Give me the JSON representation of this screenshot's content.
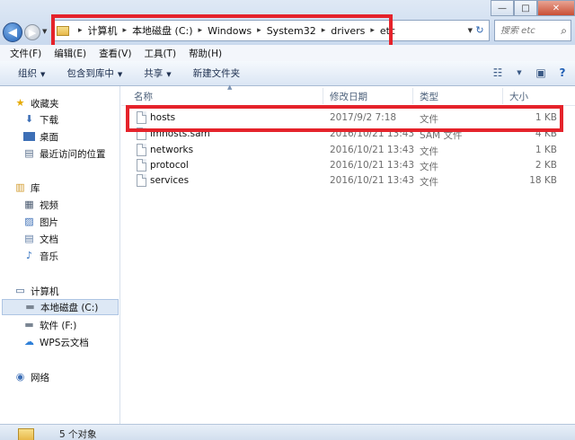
{
  "window": {
    "controls": {
      "minimize": "—",
      "maximize": "□",
      "close": "✕"
    }
  },
  "nav": {
    "back_icon": "◀",
    "forward_icon": "▶"
  },
  "address": {
    "crumbs": [
      "计算机",
      "本地磁盘 (C:)",
      "Windows",
      "System32",
      "drivers",
      "etc"
    ],
    "separator": "▸",
    "refresh_icon": "↻"
  },
  "search": {
    "placeholder": "搜索 etc"
  },
  "menubar": {
    "items": [
      "文件(F)",
      "编辑(E)",
      "查看(V)",
      "工具(T)",
      "帮助(H)"
    ]
  },
  "toolbar": {
    "organize": "组织",
    "include_in_library": "包含到库中",
    "share": "共享",
    "new_folder": "新建文件夹"
  },
  "navpane": {
    "favorites": "收藏夹",
    "downloads": "下载",
    "desktop": "桌面",
    "recent": "最近访问的位置",
    "libraries": "库",
    "videos": "视频",
    "pictures": "图片",
    "documents": "文档",
    "music": "音乐",
    "computer": "计算机",
    "local_disk": "本地磁盘 (C:)",
    "software": "软件 (F:)",
    "wps_cloud": "WPS云文档",
    "network": "网络"
  },
  "columns": {
    "name": "名称",
    "date": "修改日期",
    "type": "类型",
    "size": "大小"
  },
  "files": [
    {
      "name": "hosts",
      "date": "2017/9/2 7:18",
      "type": "文件",
      "size": "1 KB"
    },
    {
      "name": "lmhosts.sam",
      "date": "2016/10/21 13:43",
      "type": "SAM 文件",
      "size": "4 KB"
    },
    {
      "name": "networks",
      "date": "2016/10/21 13:43",
      "type": "文件",
      "size": "1 KB"
    },
    {
      "name": "protocol",
      "date": "2016/10/21 13:43",
      "type": "文件",
      "size": "2 KB"
    },
    {
      "name": "services",
      "date": "2016/10/21 13:43",
      "type": "文件",
      "size": "18 KB"
    }
  ],
  "status": {
    "text": "5 个对象"
  },
  "colors": {
    "highlight": "#e5232b",
    "accent": "#1f5fb5"
  }
}
